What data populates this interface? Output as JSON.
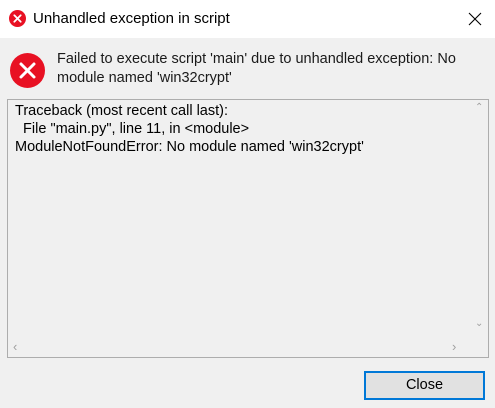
{
  "window": {
    "title": "Unhandled exception in script",
    "title_icon": "error-icon",
    "close_icon": "close-icon"
  },
  "dialog": {
    "icon": "error-icon",
    "message": "Failed to execute script 'main' due to unhandled exception: No module named 'win32crypt'",
    "traceback": "Traceback (most recent call last):\n  File \"main.py\", line 11, in <module>\nModuleNotFoundError: No module named 'win32crypt'",
    "close_button_label": "Close"
  },
  "colors": {
    "error_red": "#e81123",
    "button_focus_border": "#0078d7",
    "dialog_background": "#f0f0f0"
  }
}
